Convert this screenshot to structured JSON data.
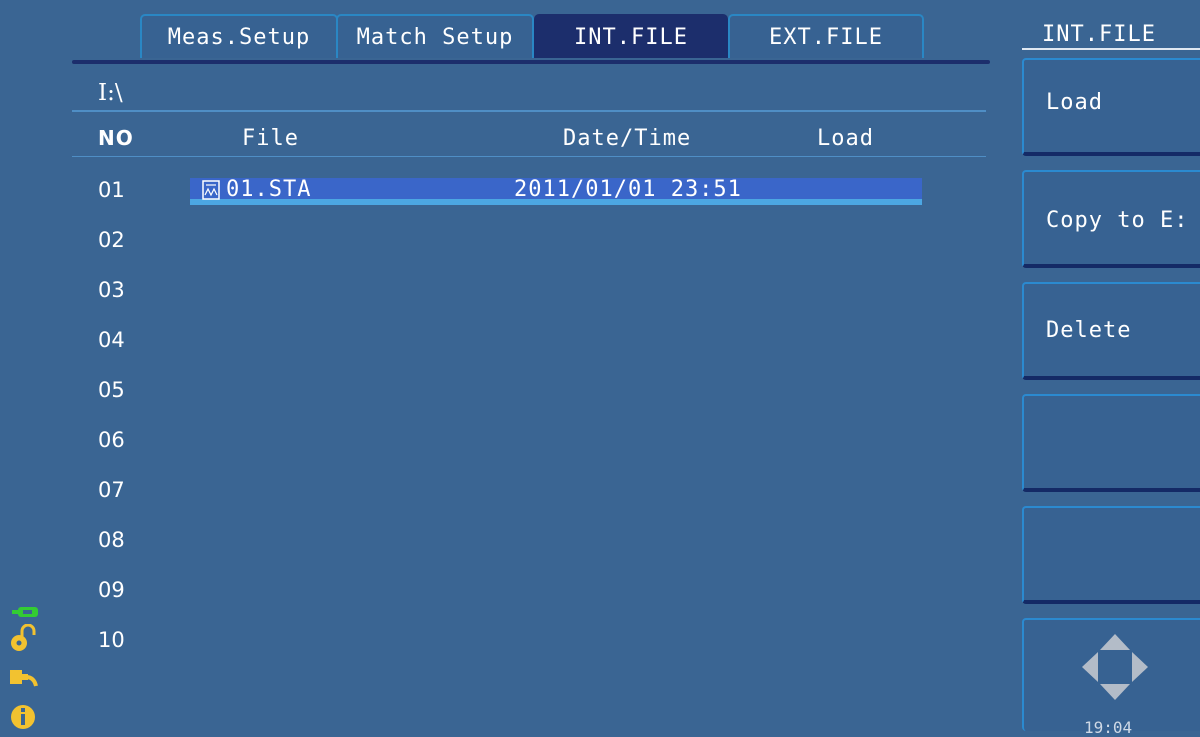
{
  "tabs": [
    {
      "label": "Meas.Setup",
      "active": false
    },
    {
      "label": "Match Setup",
      "active": false
    },
    {
      "label": "INT.FILE",
      "active": true
    },
    {
      "label": "EXT.FILE",
      "active": false
    }
  ],
  "file_browser": {
    "path": "I:\\",
    "columns": {
      "no": "NO",
      "file": "File",
      "datetime": "Date/Time",
      "load": "Load"
    },
    "rows": [
      "01",
      "02",
      "03",
      "04",
      "05",
      "06",
      "07",
      "08",
      "09",
      "10"
    ],
    "selected_file": {
      "name": "01.STA",
      "datetime": "2011/01/01 23:51",
      "icon": "file-waveform-icon"
    }
  },
  "side_panel": {
    "title": "INT.FILE",
    "softkeys": [
      "Load",
      "Copy to E:",
      "Delete",
      "",
      ""
    ],
    "clock": "19:04"
  },
  "status_icons": [
    "usb-icon",
    "unlock-icon",
    "power-plug-icon",
    "info-icon"
  ],
  "colors": {
    "background": "#3a6593",
    "active_tab": "#1c2e6c",
    "tab_border": "#2a87c4",
    "selection": "#3a66c9",
    "selection_underline": "#4ca7e3",
    "usb_icon": "#33cc33",
    "status_icon": "#f2c230"
  }
}
